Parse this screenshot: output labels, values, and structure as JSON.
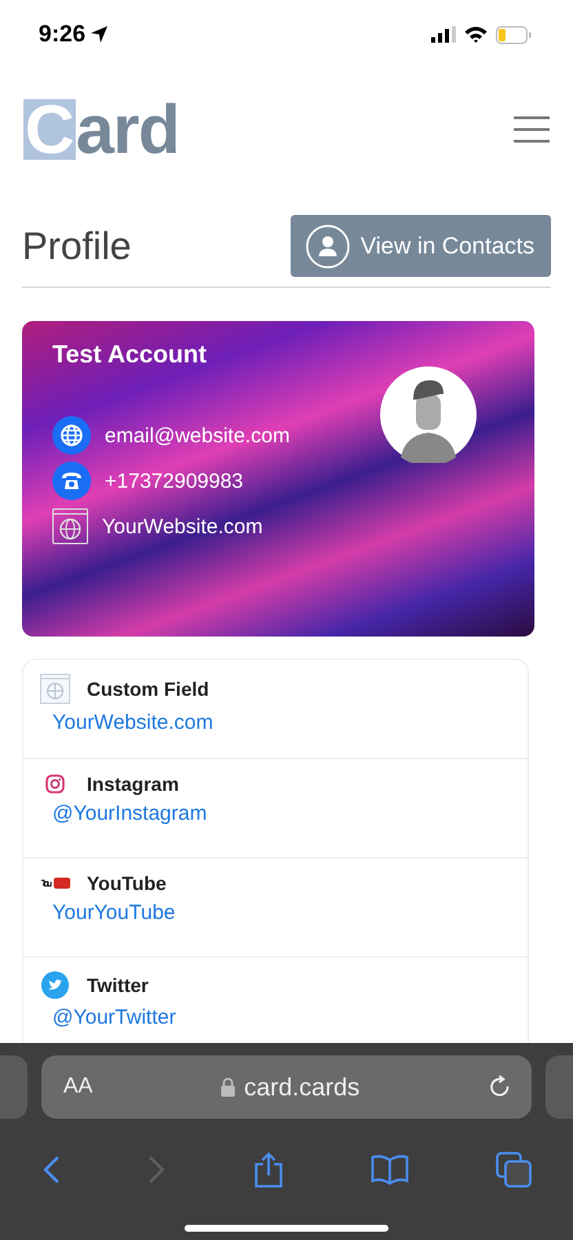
{
  "status_bar": {
    "time": "9:26"
  },
  "header": {
    "logo": "Card"
  },
  "profile": {
    "title": "Profile",
    "button": "View in Contacts"
  },
  "card": {
    "name": "Test Account",
    "contacts": [
      {
        "kind": "email",
        "text": "email@website.com"
      },
      {
        "kind": "phone",
        "text": "+17372909983"
      },
      {
        "kind": "website",
        "text": "YourWebsite.com"
      }
    ]
  },
  "links": [
    {
      "kind": "website",
      "label": "Custom Field",
      "value": "YourWebsite.com"
    },
    {
      "kind": "instagram",
      "label": "Instagram",
      "value": "@YourInstagram"
    },
    {
      "kind": "youtube",
      "label": "YouTube",
      "value": "YourYouTube"
    },
    {
      "kind": "twitter",
      "label": "Twitter",
      "value": "@YourTwitter"
    }
  ],
  "browser": {
    "text_size": "AA",
    "url": "card.cards",
    "forward_disabled": true
  }
}
